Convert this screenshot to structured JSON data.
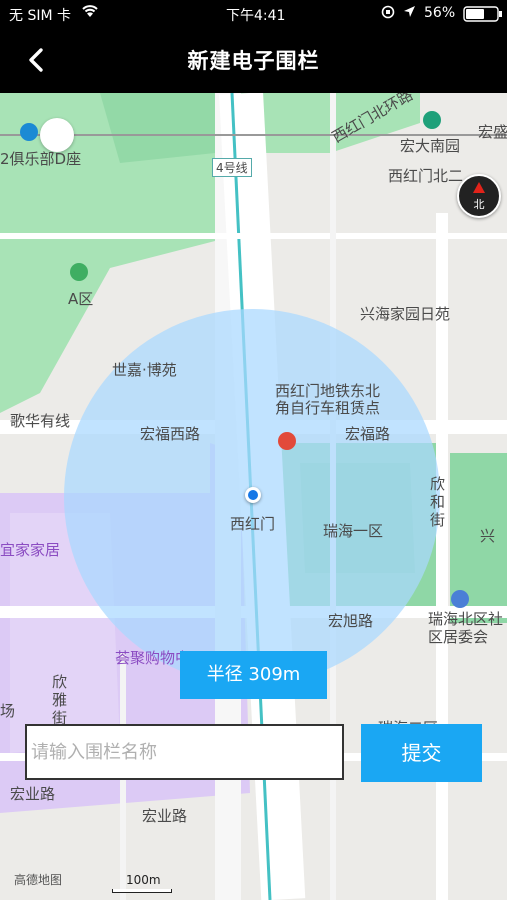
{
  "status_bar": {
    "carrier": "无 SIM 卡",
    "time": "下午4:41",
    "battery": "56%"
  },
  "nav": {
    "title": "新建电子围栏",
    "back_icon": "chevron-left-icon"
  },
  "map": {
    "labels": {
      "club": "2俱乐部D座",
      "line4": "4号线",
      "xhmbhr": "西红门北环路",
      "hongda": "宏大南园",
      "hongsheng": "宏盛",
      "xhmbe": "西红门北二",
      "area_a": "A区",
      "xinghai": "兴海家园日苑",
      "shijia": "世嘉·博苑",
      "station_poi": "西红门地铁东北角自行车租赁点",
      "gehua": "歌华有线",
      "hongfu_west": "宏福西路",
      "hongfu": "宏福路",
      "xinhejie": "欣和街",
      "xing": "兴",
      "xhm": "西红门",
      "ruihai1": "瑞海一区",
      "yijia": "宜家家居",
      "hongxu": "宏旭路",
      "ruihai_north": "瑞海北区社区居委会",
      "huiju": "荟聚购物中心",
      "xinyajie": "欣雅街",
      "chang": "场",
      "ruihai2": "瑞海二区",
      "xin": "欣",
      "hongye": "宏业路",
      "hongye2": "宏业路"
    },
    "logo": "高德地图",
    "scale": "100m"
  },
  "radius_label": "半径 309m",
  "fence_name_input": {
    "value": "",
    "placeholder": "请输入围栏名称"
  },
  "submit_label": "提交",
  "colors": {
    "accent": "#1aa7f3",
    "fence_fill": "#a9d8ff",
    "park": "#9fe0b0",
    "mall": "#dcc8f5"
  }
}
